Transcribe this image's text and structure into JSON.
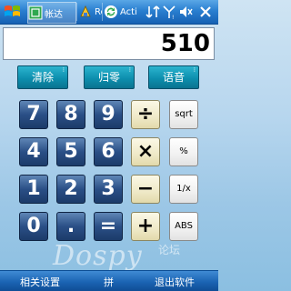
{
  "status_bar": {
    "start_icon": "windows-flag-icon",
    "tabs": [
      {
        "icon": "app-green-icon",
        "label": "帐达"
      },
      {
        "icon": "resource-icon",
        "label": "Res"
      },
      {
        "icon": "activesync-icon",
        "label": "Acti"
      }
    ],
    "icons": [
      "connectivity-icon",
      "signal-icon",
      "volume-icon",
      "close-icon"
    ]
  },
  "display": {
    "value": "510"
  },
  "functions": {
    "clear_label": "清除",
    "reset_label": "归零",
    "voice_label": "语音"
  },
  "keypad": {
    "rows": [
      [
        "7",
        "8",
        "9",
        "÷",
        "sqrt"
      ],
      [
        "4",
        "5",
        "6",
        "×",
        "%"
      ],
      [
        "1",
        "2",
        "3",
        "−",
        "1/x"
      ],
      [
        "0",
        ".",
        "=",
        "+",
        "ABS"
      ]
    ]
  },
  "watermark": {
    "text": "Dospy",
    "cn": "论坛"
  },
  "softkeys": {
    "left_label": "相关设置",
    "mid_label": "拼",
    "right_label": "退出软件"
  },
  "colors": {
    "number_key": "#2a4f86",
    "operator_key": "#efe9c7",
    "function_key": "#0d8fae",
    "taskbar": "#1b64b3"
  }
}
